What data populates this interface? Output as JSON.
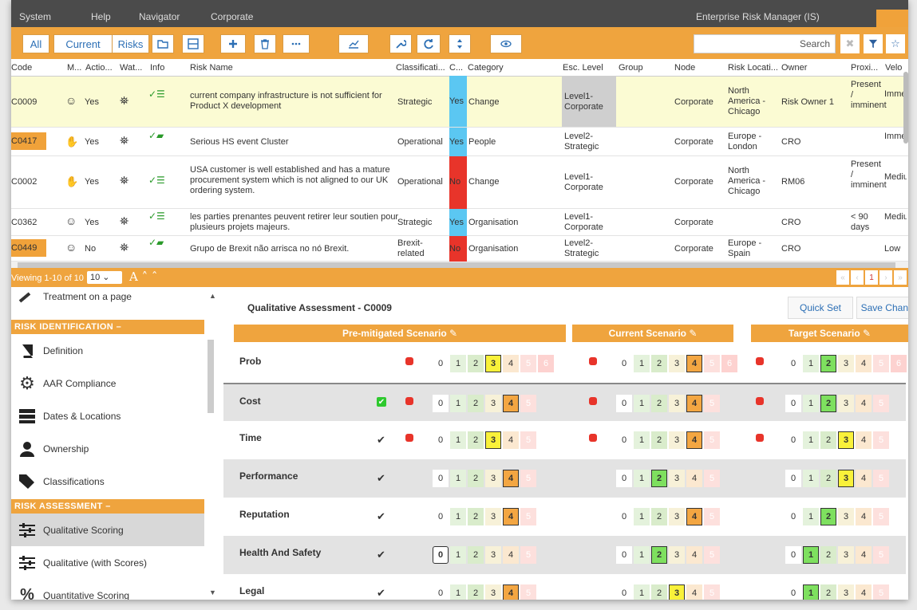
{
  "menubar": {
    "system": "System",
    "help": "Help",
    "navigator": "Navigator",
    "node": "Corporate",
    "user": "Enterprise Risk Manager (IS)"
  },
  "toolbar": {
    "all": "All",
    "current": "Current",
    "risks": "Risks",
    "search_placeholder": "Search"
  },
  "grid": {
    "headers": [
      "Code",
      "M...",
      "Actio...",
      "Wat...",
      "Info",
      "Risk Name",
      "Classificati...",
      "C...",
      "Category",
      "Esc. Level",
      "Group",
      "Node",
      "Risk Locati...",
      "Owner",
      "Proxi...",
      "Velo"
    ],
    "rows": [
      {
        "code": "C0009",
        "action": "Yes",
        "name": "current company infrastructure is not sufficient for Product X development",
        "class": "Strategic",
        "c": "Yes",
        "category": "Change",
        "esc": "Level1-Corporate",
        "node": "Corporate",
        "loc": "North America - Chicago",
        "owner": "Risk Owner 1",
        "prox": "Present / imminent",
        "velo": "Immediate"
      },
      {
        "code": "C0417",
        "action": "Yes",
        "name": "Serious HS event Cluster",
        "class": "Operational",
        "c": "Yes",
        "category": "People",
        "esc": "Level2-Strategic",
        "node": "Corporate",
        "loc": "Europe - London",
        "owner": "CRO",
        "prox": "",
        "velo": "Immediate"
      },
      {
        "code": "C0002",
        "action": "Yes",
        "name": "USA customer is well established and has a mature procurement system which is not aligned to our UK ordering system.",
        "class": "Operational",
        "c": "No",
        "category": "Change",
        "esc": "Level1-Corporate",
        "node": "Corporate",
        "loc": "North America - Chicago",
        "owner": "RM06",
        "prox": "Present / imminent",
        "velo": "Medium"
      },
      {
        "code": "C0362",
        "action": "Yes",
        "name": "les parties prenantes peuvent retirer leur soutien pour plusieurs projets majeurs.",
        "class": "Strategic",
        "c": "Yes",
        "category": "Organisation",
        "esc": "Level1-Corporate",
        "node": "Corporate",
        "loc": "",
        "owner": "CRO",
        "prox": "< 90 days",
        "velo": "Medium"
      },
      {
        "code": "C0449",
        "action": "No",
        "name": "Grupo de Brexit não arrisca no nó Brexit.",
        "class": "Brexit-related",
        "c": "No",
        "category": "Organisation",
        "esc": "Level2-Strategic",
        "node": "Corporate",
        "loc": "Europe - Spain",
        "owner": "CRO",
        "prox": "",
        "velo": "Low"
      }
    ]
  },
  "pager": {
    "viewing": "Viewing 1-10 of 10",
    "per_page": "10",
    "page": "1"
  },
  "sidebar": {
    "top_item": "Treatment on a page",
    "section1": "Risk Identification",
    "items1": [
      "Definition",
      "AAR Compliance",
      "Dates & Locations",
      "Ownership",
      "Classifications"
    ],
    "section2": "Risk Assessment",
    "items2": [
      "Qualitative Scoring",
      "Qualitative (with Scores)",
      "Quantitative Scoring"
    ]
  },
  "assessment": {
    "title": "Qualitative Assessment - C0009",
    "quick_set": "Quick Set",
    "save": "Save Changes",
    "scenarios": [
      "Pre-mitigated Scenario",
      "Current Scenario",
      "Target Scenario"
    ],
    "rows": [
      {
        "label": "Prob",
        "pre": 3,
        "cur": 4,
        "tgt": 2,
        "max": 6
      },
      {
        "label": "Cost",
        "pre": 4,
        "cur": 4,
        "tgt": 2,
        "max": 5
      },
      {
        "label": "Time",
        "pre": 3,
        "cur": 4,
        "tgt": 3,
        "max": 5
      },
      {
        "label": "Performance",
        "pre": 4,
        "cur": 2,
        "tgt": 3,
        "max": 5
      },
      {
        "label": "Reputation",
        "pre": 4,
        "cur": 4,
        "tgt": 2,
        "max": 5
      },
      {
        "label": "Health And Safety",
        "pre": 0,
        "cur": 2,
        "tgt": 1,
        "max": 5
      },
      {
        "label": "Legal",
        "pre": 4,
        "cur": 3,
        "tgt": 1,
        "max": 5
      }
    ]
  }
}
